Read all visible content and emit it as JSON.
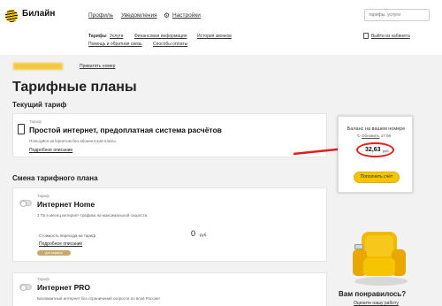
{
  "header": {
    "logo_text": "Билайн",
    "nav": {
      "profile": "Профиль",
      "notifications": "Уведомления",
      "settings": "Настройки"
    },
    "search_placeholder": "тарифы, услуги",
    "subnav": {
      "tariffs": "Тарифы",
      "services": "Услуги",
      "finance": "Финансовая информация",
      "calls_history": "История звонков",
      "help": "Помощь и обратная связь",
      "payment": "Способы оплаты"
    },
    "exit": "Выйти из кабинета"
  },
  "account": {
    "private_number": "Приватить номер"
  },
  "page_title": "Тарифные планы",
  "current_tariff": {
    "section_title": "Текущий тариф",
    "label": "Тариф",
    "name": "Простой интернет, предоплатная система расчётов",
    "description": "Пользуйся интернетом без абонентской платы.",
    "details": "Подробное описание"
  },
  "change_tariff": {
    "section_title": "Смена тарифного плана",
    "plans": [
      {
        "label": "Тариф",
        "name": "Интернет Home",
        "description": "3 ГБ в месяц интернет-трафика на максимальной скорости.",
        "cost_label": "Стоимость перехода на тариф",
        "cost_value": "0",
        "cost_unit": "руб.",
        "details": "Подробное описание",
        "badge": "для модема"
      },
      {
        "label": "Тариф",
        "name": "Интернет PRO",
        "description": "Безлимитный интернет без ограничений скорости по всей России!"
      }
    ]
  },
  "balance": {
    "title": "Баланс на вашем номере",
    "refresh_label": "Обновить",
    "refresh_time": "17:08",
    "value": "32,63",
    "unit": "руб.",
    "topup": "Пополнить счёт"
  },
  "feedback": {
    "title": "Вам понравилось?",
    "subtitle": "Оцените нашу работу"
  },
  "colors": {
    "brand_yellow": "#f6c400",
    "annotation_red": "#e0201a",
    "content_bg": "#f2f2f2"
  }
}
